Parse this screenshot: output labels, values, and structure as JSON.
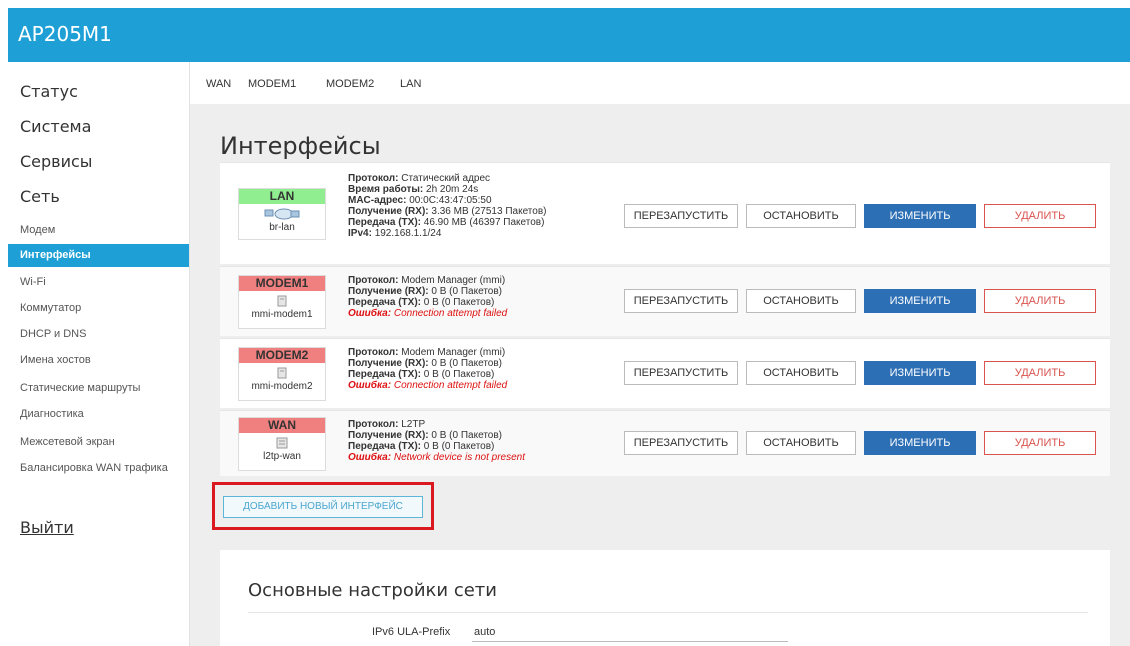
{
  "header": {
    "brand": "AP205M1"
  },
  "sidebar": {
    "top_items": [
      {
        "label": "Статус"
      },
      {
        "label": "Система"
      },
      {
        "label": "Сервисы"
      },
      {
        "label": "Сеть"
      }
    ],
    "sub_items": [
      {
        "label": "Модем"
      },
      {
        "label": "Интерфейсы"
      },
      {
        "label": "Wi-Fi"
      },
      {
        "label": "Коммутатор"
      },
      {
        "label": "DHCP и DNS"
      },
      {
        "label": "Имена хостов"
      },
      {
        "label": "Статические маршруты"
      },
      {
        "label": "Диагностика"
      },
      {
        "label": "Межсетевой экран"
      },
      {
        "label": "Балансировка WAN трафика"
      }
    ],
    "active_item": "Интерфейсы",
    "logout": "Выйти"
  },
  "tabs": [
    "WAN",
    "MODEM1",
    "MODEM2",
    "LAN"
  ],
  "page_title": "Интерфейсы",
  "interfaces": [
    {
      "name": "LAN",
      "device": "br-lan",
      "status": "up",
      "protocol_label": "Протокол:",
      "protocol": "Статический адрес",
      "uptime_label": "Время работы:",
      "uptime": "2h 20m 24s",
      "mac_label": "MAC-адрес:",
      "mac": "00:0C:43:47:05:50",
      "rx_label": "Получение (RX):",
      "rx": "3.36 MB (27513 Пакетов)",
      "tx_label": "Передача (TX):",
      "tx": "46.90 MB (46397 Пакетов)",
      "ipv4_label": "IPv4:",
      "ipv4": "192.168.1.1/24"
    },
    {
      "name": "MODEM1",
      "device": "mmi-modem1",
      "status": "down",
      "protocol_label": "Протокол:",
      "protocol": "Modem Manager (mmi)",
      "rx_label": "Получение (RX):",
      "rx": "0 B (0 Пакетов)",
      "tx_label": "Передача (TX):",
      "tx": "0 B (0 Пакетов)",
      "error_label": "Ошибка:",
      "error": "Connection attempt failed"
    },
    {
      "name": "MODEM2",
      "device": "mmi-modem2",
      "status": "down",
      "protocol_label": "Протокол:",
      "protocol": "Modem Manager (mmi)",
      "rx_label": "Получение (RX):",
      "rx": "0 B (0 Пакетов)",
      "tx_label": "Передача (TX):",
      "tx": "0 B (0 Пакетов)",
      "error_label": "Ошибка:",
      "error": "Connection attempt failed"
    },
    {
      "name": "WAN",
      "device": "l2tp-wan",
      "status": "down",
      "protocol_label": "Протокол:",
      "protocol": "L2TP",
      "rx_label": "Получение (RX):",
      "rx": "0 B (0 Пакетов)",
      "tx_label": "Передача (TX):",
      "tx": "0 B (0 Пакетов)",
      "error_label": "Ошибка:",
      "error": "Network device is not present"
    }
  ],
  "buttons": {
    "restart": "ПЕРЕЗАПУСТИТЬ",
    "stop": "ОСТАНОВИТЬ",
    "edit": "ИЗМЕНИТЬ",
    "delete": "УДАЛИТЬ",
    "add_interface": "ДОБАВИТЬ НОВЫЙ ИНТЕРФЕЙС"
  },
  "settings": {
    "title": "Основные настройки сети",
    "ula_label": "IPv6 ULA-Prefix",
    "ula_value": "auto"
  },
  "colors": {
    "header_bg": "#1ea0d6",
    "active_nav": "#1ea0d6",
    "status_up": "#90ee90",
    "status_down": "#f08080",
    "edit_button": "#2d6fb5",
    "delete_button": "#d9534f",
    "error_text": "#dd1111",
    "highlight_box": "#d9181f"
  },
  "icons": {
    "lan": "bridge-network-icon",
    "modem": "modem-device-icon",
    "wan": "tunnel-device-icon"
  }
}
